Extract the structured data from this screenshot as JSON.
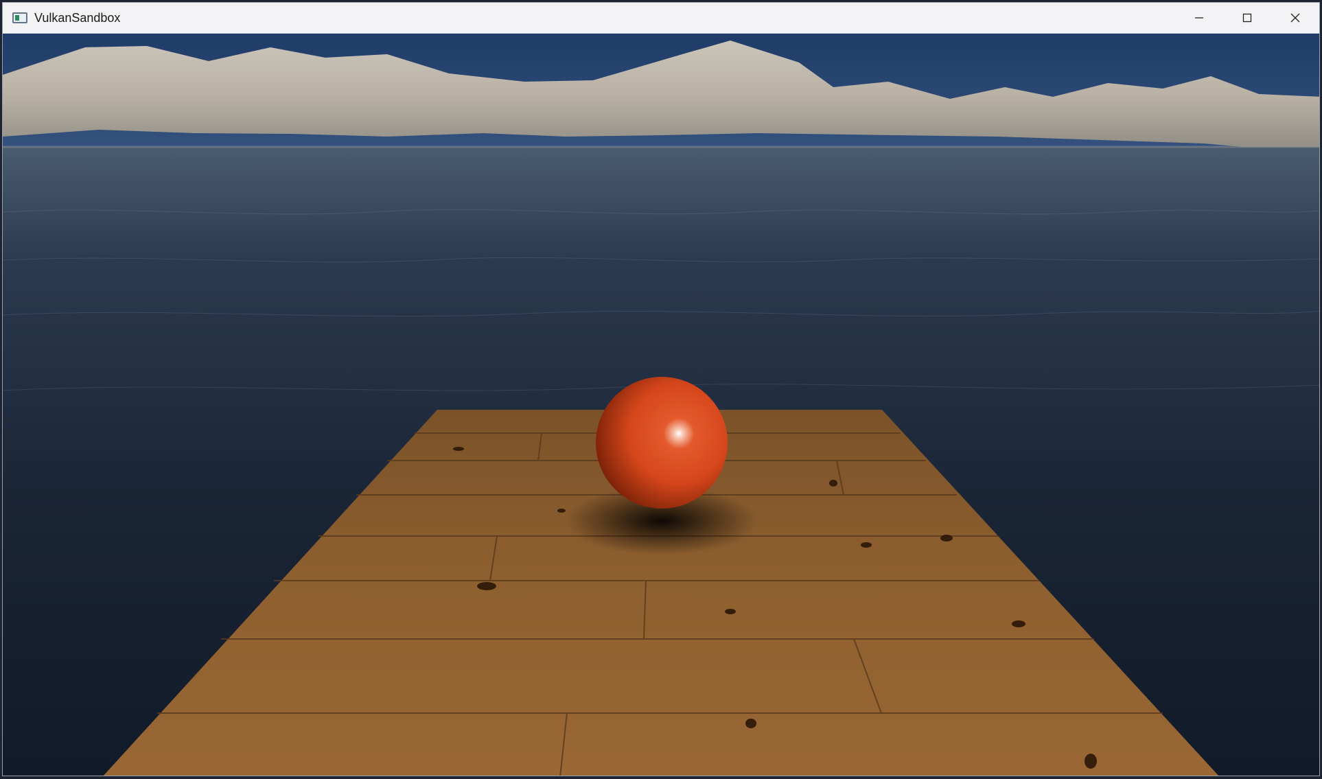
{
  "window": {
    "title": "VulkanSandbox",
    "controls": [
      {
        "name": "minimize",
        "icon": "minimize-icon"
      },
      {
        "name": "maximize",
        "icon": "maximize-icon"
      },
      {
        "name": "close",
        "icon": "close-icon"
      }
    ]
  },
  "scene": {
    "sky_color": "#6b87b0",
    "mountain_color": "#b9b2a7",
    "water_color": "#1b2433",
    "deck_color": "#8a5a2c",
    "ball_color": "#d5461b"
  }
}
